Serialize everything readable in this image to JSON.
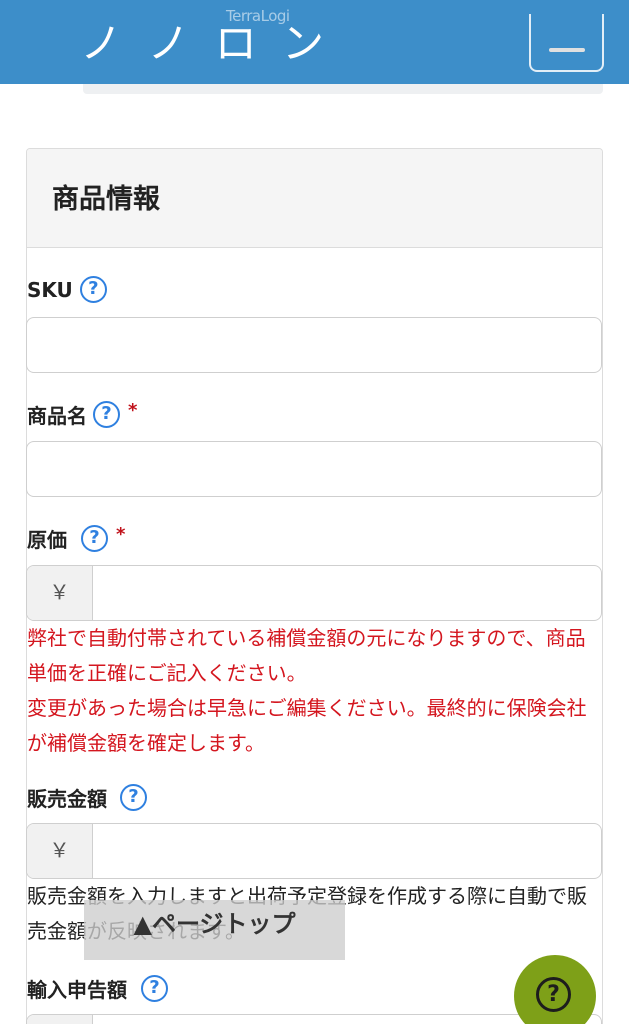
{
  "header": {
    "brand": "TerraLogi",
    "title_cut": "ノ ノ ロ ン",
    "menu_icon": "hamburger-menu-icon",
    "background": "#3d8ec9"
  },
  "card": {
    "title": "商品情報"
  },
  "fields": {
    "sku": {
      "label": "SKU",
      "value": ""
    },
    "product_name": {
      "label": "商品名",
      "required_mark": "*",
      "value": ""
    },
    "cost_price": {
      "label": "原価",
      "required_mark": "*",
      "currency": "￥",
      "value": ""
    },
    "sales_amount": {
      "label": "販売金額",
      "currency": "￥",
      "value": ""
    },
    "import_declaration": {
      "label": "輸入申告額",
      "currency": "￥",
      "value": ""
    }
  },
  "notes": {
    "cost_line1": "弊社で自動付帯されている補償金額の元になりますので、商品単価を正確にご記入ください。",
    "cost_line2": "変更があった場合は早急にご編集ください。最終的に保険会社が補償金額を確定します。",
    "sales": "販売金額を入力しますと出荷予定登録を作成する際に自動で販売金額が反映されます。"
  },
  "help_glyph": "?",
  "page_top_label": "▲ページトップ",
  "fab": {
    "glyph": "?",
    "icon": "help-circle-icon",
    "color": "#7ea018"
  },
  "colors": {
    "required": "#c0121b",
    "note_red": "#d4161f",
    "help": "#2f80e0"
  }
}
